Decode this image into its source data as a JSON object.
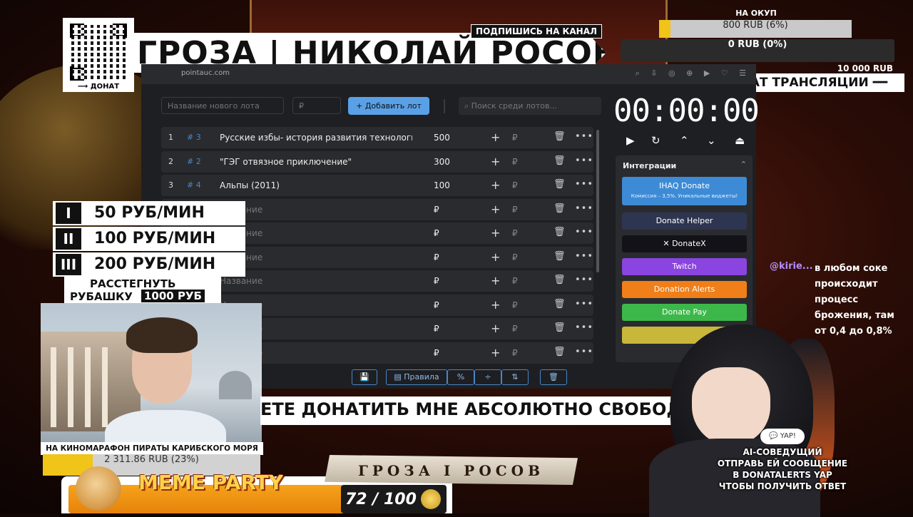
{
  "overlay": {
    "qr_label": "⟶ ДОНАТ",
    "subscribe": "ПОДПИШИСЬ НА КАНАЛ",
    "title": "ГРОЗА | НИКОЛАЙ РОСОВ"
  },
  "goals": {
    "payback_title": "НА ОКУП",
    "payback_value": "800 RUB (6%)",
    "payback_fraction": 0.06,
    "current_value": "0 RUB (0%)",
    "target": "10 000 RUB",
    "chat_title": "ЧАТ ТРАНСЛЯЦИИ ━━"
  },
  "browser": {
    "url": "pointauc.com",
    "url_icons": "⌕ ⇩ ◎ ⊕ ▶ ♡ ☰"
  },
  "auction": {
    "new_lot_placeholder": "Название нового лота",
    "price_placeholder": "₽",
    "add_button": "+  Добавить лот",
    "search_placeholder": "Поиск среди лотов...",
    "empty_name": "Название",
    "currency": "₽",
    "plus": "+",
    "trash": "🗑",
    "more": "•••",
    "lots": [
      {
        "num": "1",
        "id": "# 3",
        "name": "Русские избы- история развития технологи",
        "amount": "500"
      },
      {
        "num": "2",
        "id": "# 2",
        "name": "\"ГЭГ отвязное приключение\"",
        "amount": "300"
      },
      {
        "num": "3",
        "id": "# 4",
        "name": "Альпы (2011)",
        "amount": "100"
      },
      {
        "num": "",
        "id": "",
        "name": "",
        "amount": ""
      },
      {
        "num": "",
        "id": "",
        "name": "",
        "amount": ""
      },
      {
        "num": "",
        "id": "",
        "name": "",
        "amount": ""
      },
      {
        "num": "",
        "id": "",
        "name": "",
        "amount": ""
      },
      {
        "num": "",
        "id": "",
        "name": "",
        "amount": ""
      },
      {
        "num": "",
        "id": "",
        "name": "",
        "amount": ""
      },
      {
        "num": "",
        "id": "",
        "name": "",
        "amount": ""
      }
    ],
    "tools": {
      "save": "💾",
      "rules": "▤ Правила",
      "percent": "%",
      "divide": "÷",
      "sort": "⇅",
      "clear": "🗑"
    },
    "timer": "00:00:00",
    "timer_controls": {
      "play": "▶",
      "reset": "↻",
      "up": "⌃",
      "down": "⌄",
      "top": "⏏"
    },
    "integrations_title": "Интеграции",
    "integrations_chevron": "⌃",
    "integrations": [
      {
        "label": "IHAQ Donate",
        "sub": "Комиссия – 3,5%. Уникальные виджеты!",
        "color": "#3d8bd6"
      },
      {
        "label": "Donate Helper",
        "color": "#2e3550"
      },
      {
        "label": "✕  DonateX",
        "color": "#121218"
      },
      {
        "label": "Twitch",
        "color": "#8a44e0"
      },
      {
        "label": "Donation Alerts",
        "color": "#f07f1a"
      },
      {
        "label": "Donate Pay",
        "color": "#3cb84a"
      },
      {
        "label": "",
        "color": "#c8b73a"
      }
    ]
  },
  "left_panel": {
    "rates": [
      {
        "roman": "I",
        "text": "50 РУБ/МИН"
      },
      {
        "roman": "II",
        "text": "100 РУБ/МИН"
      },
      {
        "roman": "III",
        "text": "200 РУБ/МИН"
      }
    ],
    "shirt_line1": "РАССТЕГНУТЬ",
    "shirt_line2": "РУБАШКУ",
    "shirt_price": "1000 РУБ",
    "marathon": "НА КИНОМАРАФОН ПИРАТЫ КАРИБСКОГО МОРЯ",
    "marathon_value": "2 311.86 RUB (23%)",
    "marathon_fraction": 0.23
  },
  "meme": {
    "title": "MEME PARTY",
    "count": "72 / 100",
    "count_value": 72,
    "count_max": 100
  },
  "ticker": "ЕТЕ ДОНАТИТЬ МНЕ АБСОЛЮТНО СВОБОДНО, БЕСКОНЕЧНО",
  "tagline": "ГРОЗА I РОСОВ",
  "chat": {
    "user": "@kirie...",
    "message": "в любом соке происходит процесс брожения, там от 0,4 до 0,8%"
  },
  "ai": {
    "badge": "💬 YAP!",
    "line1": "AI-СОВЕДУЩИЙ",
    "line2": "ОТПРАВЬ ЕЙ СООБЩЕНИЕ",
    "line3": "В DONATALERTS  YAP",
    "line4": "ЧТОБЫ ПОЛУЧИТЬ ОТВЕТ"
  }
}
